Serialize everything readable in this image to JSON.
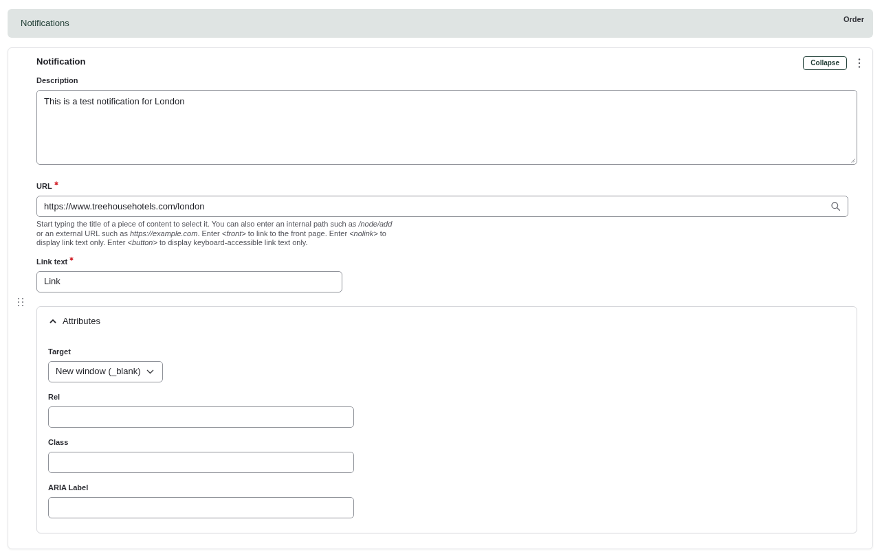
{
  "table_header": {
    "columns": [
      "Notifications",
      "Order"
    ]
  },
  "paragraph": {
    "title": "Notification",
    "collapse_button": "Collapse",
    "fields": [
      {
        "kind": "textarea",
        "label": "Description",
        "required": false,
        "value": "This is a test notification for London"
      },
      {
        "kind": "autocomplete",
        "label": "URL",
        "required": true,
        "value": "https://www.treehousehotels.com/london",
        "description": "Start typing the title of a piece of content to select it. You can also enter an internal path such as */node/add* or an external URL such as *https://example.com*. Enter *<front>* to link to the front page. Enter *<nolink>* to display link text only. Enter *<button>* to display keyboard-accessible link text only."
      },
      {
        "kind": "text",
        "label": "Link text",
        "required": true,
        "value": "Link"
      }
    ],
    "attributes": {
      "title": "Attributes",
      "expanded": true,
      "fields": [
        {
          "kind": "select",
          "label": "Target",
          "required": false,
          "value": "New window (_blank)"
        },
        {
          "kind": "text",
          "label": "Rel",
          "required": false
        },
        {
          "kind": "text",
          "label": "Class",
          "required": false
        },
        {
          "kind": "text",
          "label": "ARIA Label",
          "required": false
        }
      ]
    }
  }
}
